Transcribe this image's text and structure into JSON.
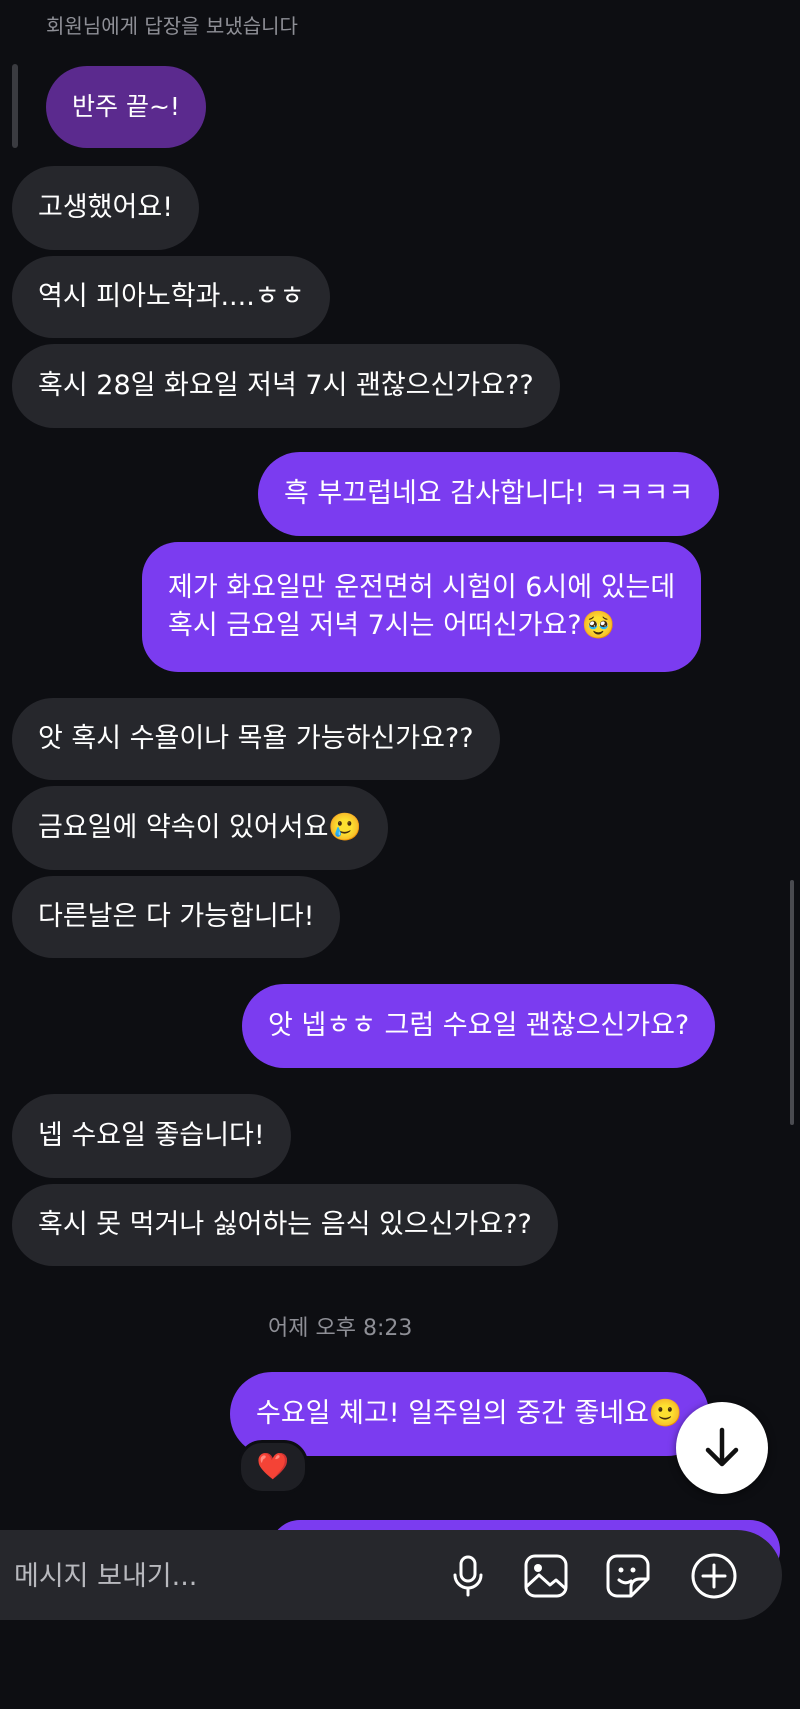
{
  "thread": {
    "reply_label": "회원님에게 답장을 보냈습니다",
    "quoted_message": "반주 끝~!",
    "timestamp": "어제 오후 8:23"
  },
  "messages": [
    {
      "side": "in",
      "text": "고생했어요!"
    },
    {
      "side": "in",
      "text": "역시 피아노학과....ㅎㅎ"
    },
    {
      "side": "in",
      "text": "혹시 28일 화요일 저녁 7시 괜찮으신가요??"
    },
    {
      "side": "out",
      "text": "흑 부끄럽네요 감사합니다! ㅋㅋㅋㅋ"
    },
    {
      "side": "out",
      "text": "제가 화요일만 운전면허 시험이 6시에 있는데\n혹시 금요일 저녁 7시는 어떠신가요?🥹"
    },
    {
      "side": "in",
      "text": "앗 혹시 수욜이나 목욜 가능하신가요??"
    },
    {
      "side": "in",
      "text": "금요일에 약속이 있어서요🥲"
    },
    {
      "side": "in",
      "text": "다른날은 다 가능합니다!"
    },
    {
      "side": "out",
      "text": "앗 넵ㅎㅎ 그럼 수요일 괜찮으신가요?"
    },
    {
      "side": "in",
      "text": "넵 수요일 좋습니다!"
    },
    {
      "side": "in",
      "text": "혹시 못 먹거나 싫어하는 음식 있으신가요??"
    },
    {
      "side": "out",
      "text": "수요일 체고! 일주일의 중간 좋네요🙂"
    }
  ],
  "reaction": {
    "emoji": "❤️"
  },
  "composer": {
    "placeholder": "메시지 보내기...",
    "icons": [
      "microphone-icon",
      "image-icon",
      "sticker-icon",
      "plus-circle-icon"
    ]
  },
  "colors": {
    "background": "#0d0e12",
    "incoming_bubble": "#26272c",
    "outgoing_bubble": "#7b3cf0",
    "quoted_bubble": "#5b2a8e",
    "meta_text": "#8e8f96"
  }
}
